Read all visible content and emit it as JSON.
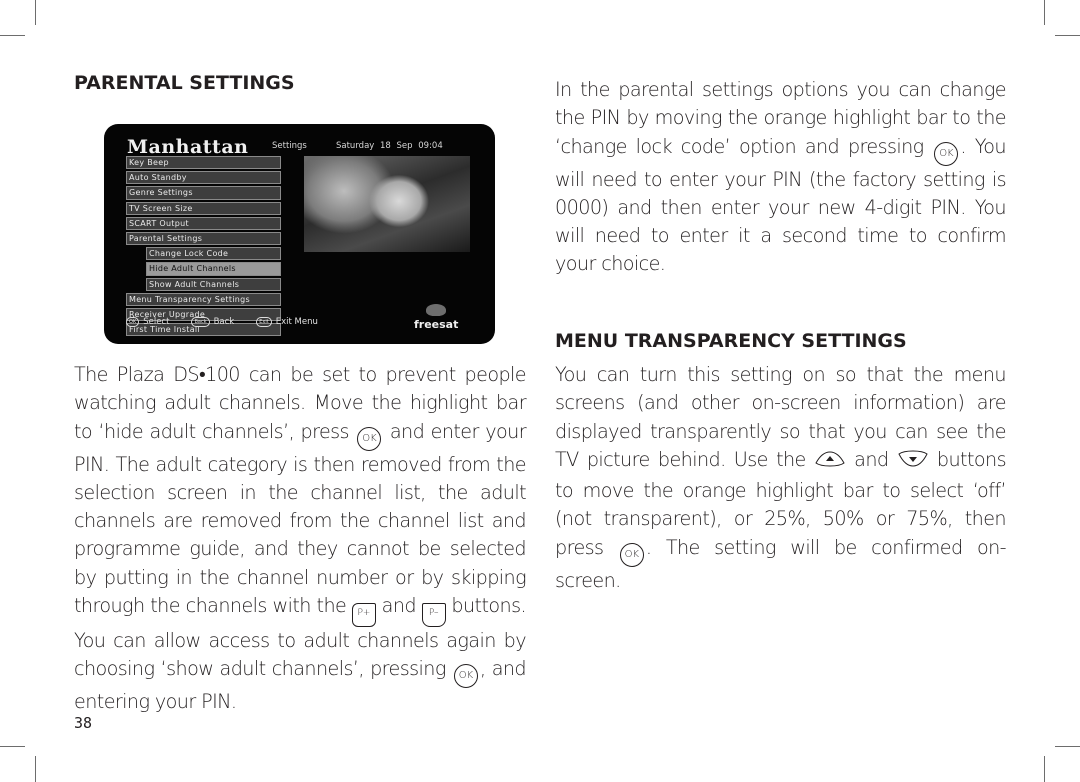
{
  "page": {
    "page_number": "38"
  },
  "left": {
    "heading": "PARENTAL SETTINGS",
    "tv_screen": {
      "brand": "Manhattan",
      "section": "Settings",
      "datetime": "Saturday 18 Sep  09:04",
      "menu_items": [
        {
          "label": "Key Beep",
          "sub": false,
          "active": false
        },
        {
          "label": "Auto Standby",
          "sub": false,
          "active": false
        },
        {
          "label": "Genre Settings",
          "sub": false,
          "active": false
        },
        {
          "label": "TV Screen Size",
          "sub": false,
          "active": false
        },
        {
          "label": "SCART Output",
          "sub": false,
          "active": false
        },
        {
          "label": "Parental Settings",
          "sub": false,
          "active": false
        },
        {
          "label": "Change Lock Code",
          "sub": true,
          "active": false
        },
        {
          "label": "Hide Adult Channels",
          "sub": true,
          "active": true
        },
        {
          "label": "Show Adult Channels",
          "sub": true,
          "active": false
        },
        {
          "label": "Menu Transparency Settings",
          "sub": false,
          "active": false
        },
        {
          "label": "Receiver Upgrade",
          "sub": false,
          "active": false
        },
        {
          "label": "First Time Install",
          "sub": false,
          "active": false
        }
      ],
      "footer": {
        "select_icon": "OK",
        "select_label": "Select",
        "back_icon": "Back",
        "back_label": "Back",
        "exit_icon": "Exit",
        "exit_label": "Exit Menu"
      },
      "logo_text": "freesat"
    },
    "paragraph": {
      "part1": "The Plaza DS•100 can be set to prevent people watching adult channels. Move the highlight bar to ‘hide adult channels’, press ",
      "ok1": "OK",
      "part2": " and enter your PIN. The adult category is then removed from the selection screen in the channel list, the adult channels are removed from the channel list and programme guide, and they cannot be selected by putting in the channel number or by skipping through the channels with the ",
      "p_plus": "P+",
      "and": " and ",
      "p_minus": "P–",
      "part3": " buttons. You can allow access to adult channels again by choosing ‘show adult channels’, pressing ",
      "ok2": "OK",
      "part4": ", and entering your PIN."
    }
  },
  "right": {
    "intro": {
      "part1": "In the parental settings options you can change the PIN by moving the orange highlight bar to the ‘change lock code’ option and pressing ",
      "ok": "OK",
      "part2": ".  You will need to enter your PIN (the factory setting is 0000) and then enter your new 4-digit PIN. You will need to enter it a second time to confirm your choice."
    },
    "heading": "MENU TRANSPARENCY SETTINGS",
    "paragraph": {
      "part1": "You can turn this setting on so that the menu screens (and other on-screen information) are displayed transparently so that you can see the TV picture behind. Use the ",
      "up_icon": "up-arrow-button",
      "and": " and ",
      "down_icon": "down-arrow-button",
      "part2": " buttons to move the orange highlight bar to select ‘off’ (not transparent), or 25%, 50% or 75%, then press ",
      "ok": "OK",
      "part3": ". The setting will be confirmed on-screen."
    }
  }
}
